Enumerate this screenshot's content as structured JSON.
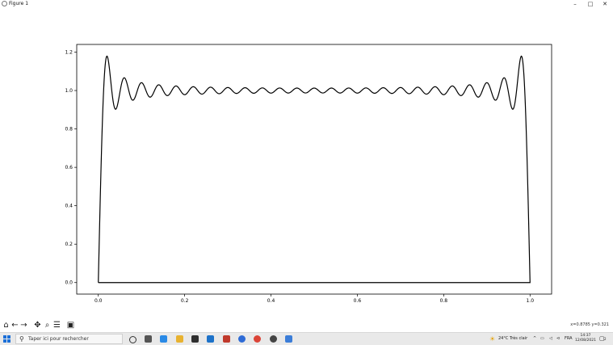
{
  "window": {
    "title": "Figure 1",
    "minimize": "–",
    "maximize": "□",
    "close": "✕"
  },
  "toolbar": {
    "buttons": [
      "home-icon",
      "back-icon",
      "forward-icon",
      "pan-icon",
      "zoom-icon",
      "configure-icon",
      "save-icon"
    ],
    "coords": "x=0.8785 y=0.321"
  },
  "chart_data": {
    "type": "line",
    "xlim": [
      -0.05,
      1.05
    ],
    "ylim": [
      -0.06,
      1.24
    ],
    "xticks": [
      0.0,
      0.2,
      0.4,
      0.6,
      0.8,
      1.0
    ],
    "xtick_labels": [
      "0.0",
      "0.2",
      "0.4",
      "0.6",
      "0.8",
      "1.0"
    ],
    "yticks": [
      0.0,
      0.2,
      0.4,
      0.6,
      0.8,
      1.0,
      1.2
    ],
    "ytick_labels": [
      "0.0",
      "0.2",
      "0.4",
      "0.6",
      "0.8",
      "1.0",
      "1.2"
    ],
    "harmonics": 25,
    "x_range": [
      0,
      1
    ],
    "grid": false,
    "line_color": "#000000",
    "description_free": true
  },
  "taskbar": {
    "search_placeholder": "Taper ici pour rechercher",
    "weather": "24°C  Très clair",
    "language": "FRA",
    "time": "14:37",
    "date": "12/08/2021",
    "notification_count": "2"
  }
}
